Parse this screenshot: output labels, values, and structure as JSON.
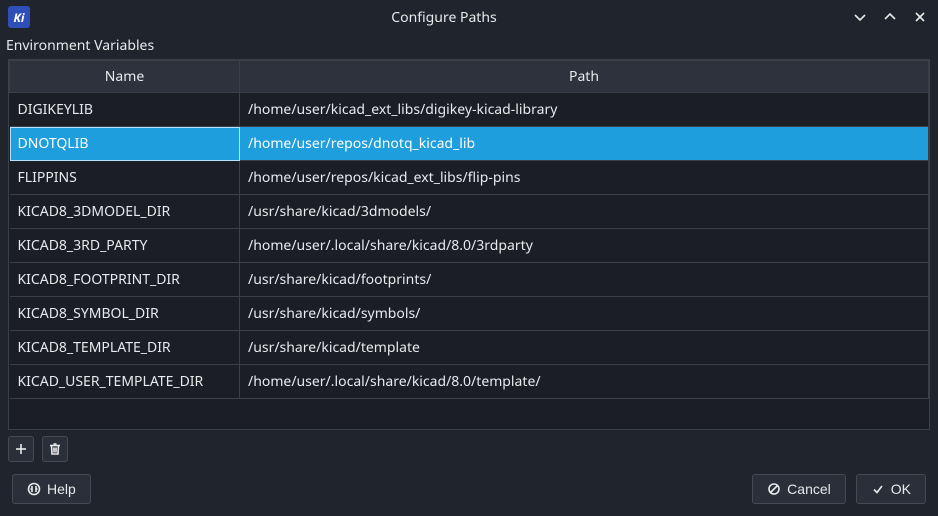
{
  "window": {
    "title": "Configure Paths",
    "app_icon_text": "Ki"
  },
  "section_label": "Environment Variables",
  "grid": {
    "headers": {
      "name": "Name",
      "path": "Path"
    },
    "rows": [
      {
        "name": "DIGIKEYLIB",
        "path": "/home/user/kicad_ext_libs/digikey-kicad-library",
        "selected": false
      },
      {
        "name": "DNOTQLIB",
        "path": "/home/user/repos/dnotq_kicad_lib",
        "selected": true
      },
      {
        "name": "FLIPPINS",
        "path": "/home/user/repos/kicad_ext_libs/flip-pins",
        "selected": false
      },
      {
        "name": "KICAD8_3DMODEL_DIR",
        "path": "/usr/share/kicad/3dmodels/",
        "selected": false
      },
      {
        "name": "KICAD8_3RD_PARTY",
        "path": "/home/user/.local/share/kicad/8.0/3rdparty",
        "selected": false
      },
      {
        "name": "KICAD8_FOOTPRINT_DIR",
        "path": "/usr/share/kicad/footprints/",
        "selected": false
      },
      {
        "name": "KICAD8_SYMBOL_DIR",
        "path": "/usr/share/kicad/symbols/",
        "selected": false
      },
      {
        "name": "KICAD8_TEMPLATE_DIR",
        "path": "/usr/share/kicad/template",
        "selected": false
      },
      {
        "name": "KICAD_USER_TEMPLATE_DIR",
        "path": "/home/user/.local/share/kicad/8.0/template/",
        "selected": false
      }
    ]
  },
  "buttons": {
    "help": "Help",
    "cancel": "Cancel",
    "ok": "OK"
  }
}
